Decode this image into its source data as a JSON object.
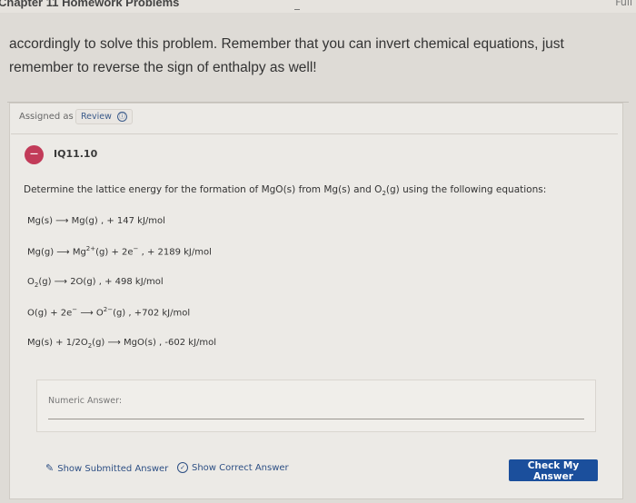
{
  "header": {
    "chapter_title": "Chapter 11 Homework Problems",
    "corner_text": "Full"
  },
  "instructions": "accordingly to solve this problem. Remember that you can invert chemical equations, just remember to reverse the sign of enthalpy as well!",
  "assignment": {
    "assigned_label": "Assigned as",
    "review_label": "Review",
    "info_icon": "ⓘ"
  },
  "question": {
    "icon_text": "—",
    "id": "IQ11.10",
    "prompt_pre": "Determine the lattice energy for the formation of MgO(s) from Mg(s) and O",
    "prompt_sub": "2",
    "prompt_post": "(g) using the following equations:"
  },
  "equations": {
    "e1": {
      "text": "Mg(s) ⟶ Mg(g) , + 147 kJ/mol"
    },
    "e2": {
      "a": "Mg(g) ⟶ Mg",
      "sup": "2+",
      "b": "(g) + 2e",
      "sup2": "−",
      "c": " , + 2189 kJ/mol"
    },
    "e3": {
      "a": "O",
      "sub": "2",
      "b": "(g) ⟶ 2O(g) , + 498 kJ/mol"
    },
    "e4": {
      "a": "O(g) + 2e",
      "sup": "−",
      "b": " ⟶ O",
      "sup2": "2−",
      "c": "(g) , +702 kJ/mol"
    },
    "e5": {
      "a": "Mg(s) + 1/2O",
      "sub": "2",
      "b": "(g) ⟶ MgO(s) , -602 kJ/mol"
    }
  },
  "answer": {
    "label": "Numeric Answer:",
    "value": ""
  },
  "actions": {
    "show_submitted": "Show Submitted Answer",
    "show_correct": "Show Correct Answer",
    "check": "Check My Answer",
    "pencil_icon": "✎",
    "check_icon": "✓"
  },
  "colors": {
    "accent": "#1b4f9c",
    "link": "#2d4f84",
    "question_icon": "#c23b59"
  }
}
